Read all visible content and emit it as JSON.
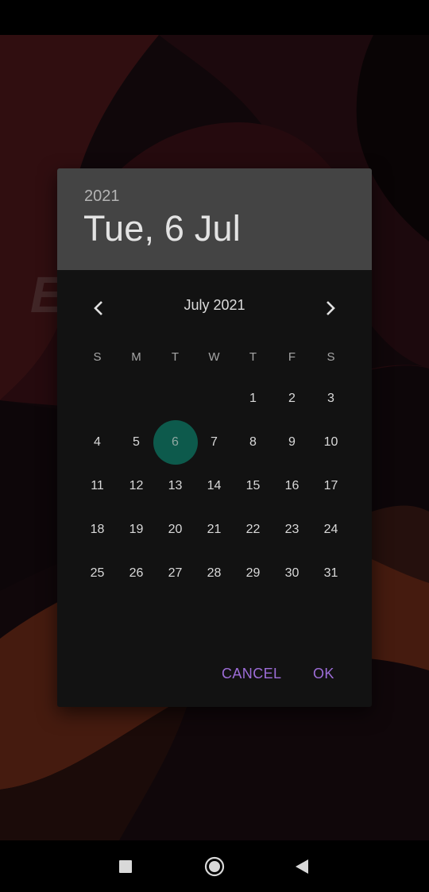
{
  "header": {
    "year": "2021",
    "date": "Tue, 6 Jul"
  },
  "month_nav": {
    "title": "July 2021",
    "prev_icon": "chevron-left",
    "next_icon": "chevron-right"
  },
  "weekdays": [
    "S",
    "M",
    "T",
    "W",
    "T",
    "F",
    "S"
  ],
  "days": [
    "",
    "",
    "",
    "",
    "1",
    "2",
    "3",
    "4",
    "5",
    "6",
    "7",
    "8",
    "9",
    "10",
    "11",
    "12",
    "13",
    "14",
    "15",
    "16",
    "17",
    "18",
    "19",
    "20",
    "21",
    "22",
    "23",
    "24",
    "25",
    "26",
    "27",
    "28",
    "29",
    "30",
    "31"
  ],
  "selected_day": "6",
  "actions": {
    "cancel": "CANCEL",
    "ok": "OK"
  },
  "background_text": "E",
  "colors": {
    "header_bg": "#444444",
    "dialog_bg": "#121212",
    "selected_circle": "#0d5a4c",
    "accent": "#9d6dd8"
  },
  "system_nav": {
    "recent": "square-icon",
    "home": "circle-icon",
    "back": "triangle-icon"
  }
}
